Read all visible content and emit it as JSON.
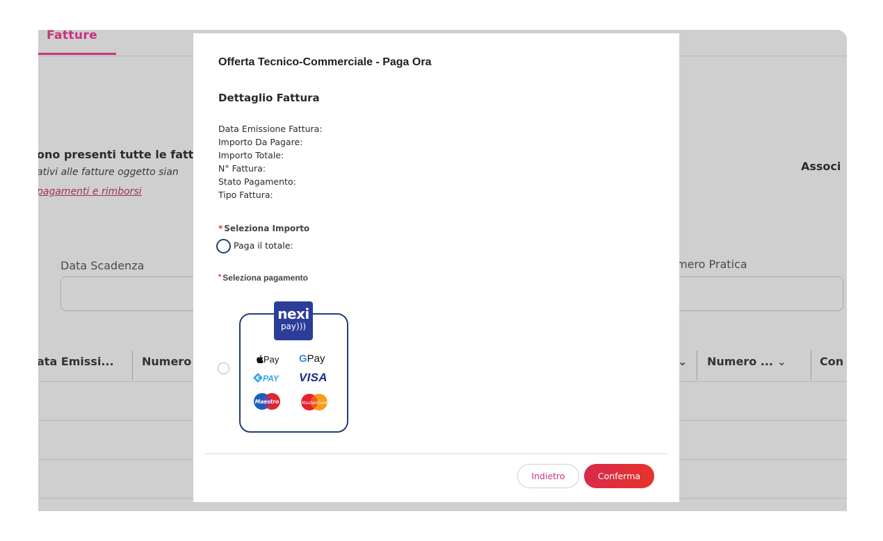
{
  "background": {
    "tab_label": "Fatture",
    "notice_bold": "ono presenti tutte le fatt",
    "notice_italic": "ativi alle fatture oggetto sian",
    "notice_link": "pagamenti e rimborsi",
    "right_bold": "Associ",
    "filter_left_label": "Data Scadenza",
    "filter_right_label": "mero Pratica",
    "columns": [
      "ata Emissi...",
      "Numero",
      "Numero ...",
      "Con"
    ]
  },
  "modal": {
    "title": "Offerta Tecnico-Commerciale - Paga Ora",
    "section_title": "Dettaglio Fattura",
    "details": [
      "Data Emissione Fattura:",
      "Importo Da Pagare:",
      "Importo Totale:",
      "N° Fattura:",
      "Stato Pagamento:",
      "Tipo Fattura:"
    ],
    "select_amount_label": "Seleziona Importo",
    "pay_total_label": "Paga il totale:",
    "select_payment_label": "Seleziona pagamento",
    "required_marker": "*",
    "payment_method": {
      "brand_line1": "nexi",
      "brand_line2": "pay",
      "logos": {
        "apple_pay": "Pay",
        "google_pay_g": "G",
        "google_pay": "Pay",
        "epay": "PAY",
        "visa": "VISA",
        "maestro": "Maestro",
        "mastercard": "MasterCard"
      }
    },
    "back_button": "Indietro",
    "confirm_button": "Conferma"
  },
  "colors": {
    "accent": "#c6337e",
    "navy": "#1f3d7a",
    "confirm_red": "#e0334a",
    "nexi_blue": "#2b3d98"
  }
}
